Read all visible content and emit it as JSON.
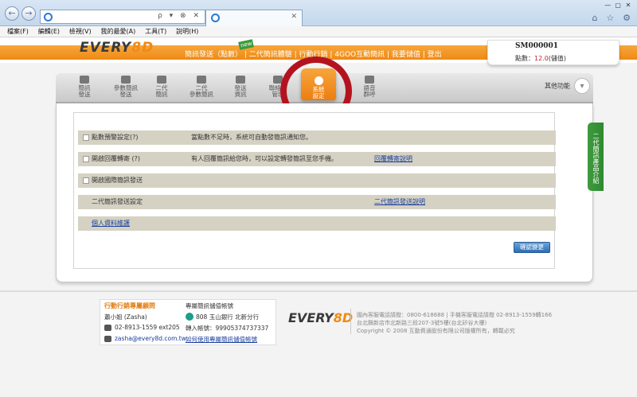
{
  "browser": {
    "back": "←",
    "forward": "→",
    "address_controls": "ρ ▾ ⊗ ✕",
    "tab_close": "✕",
    "window_controls": [
      "—",
      "▢",
      "✕"
    ],
    "right_icons": [
      "⌂",
      "☆",
      "⚙"
    ]
  },
  "menubar": [
    "檔案(F)",
    "編輯(E)",
    "檢視(V)",
    "我的最愛(A)",
    "工具(T)",
    "說明(H)"
  ],
  "site": {
    "logo_prefix": "EVERY",
    "logo_suffix": "8D",
    "new_badge": "new",
    "topnav": "簡訊發送（點數） | 二代簡訊體驗 | 行動行銷 | 4GOO互動簡訊 | 我要儲值 | 登出",
    "account": {
      "id": "SM000001",
      "points_label": "點數：",
      "points_value": "12.0",
      "topup": "(儲值)"
    }
  },
  "toolbar": {
    "items": [
      {
        "label": "簡訊\n發送"
      },
      {
        "label": "參數簡訊\n發送"
      },
      {
        "label": "二代\n簡訊"
      },
      {
        "label": "二代\n參數簡訊"
      },
      {
        "label": "發送\n資訊"
      },
      {
        "label": "聯絡人\n管理"
      },
      {
        "label": "系統\n設定"
      },
      {
        "label": "語音\n群呼"
      }
    ],
    "other": "其他功能",
    "other_icon": "▾"
  },
  "settings": {
    "rows": [
      {
        "label": "點數預警設定(?)",
        "desc": "當點數不足時，系統可自動發簡訊通知您。",
        "link": ""
      },
      {
        "label": "開啟回覆轉寄 (?)",
        "desc": "有人回覆簡訊給您時，可以設定轉發簡訊至您手機。",
        "link": "回覆轉寄說明"
      },
      {
        "label": "開啟國際簡訊發送",
        "desc": "",
        "link": ""
      },
      {
        "label": "二代簡訊發送設定",
        "desc": "",
        "link": "二代簡訊發送說明"
      },
      {
        "label": "個人資料維護",
        "desc": "",
        "link": ""
      }
    ],
    "confirm": "確認變更"
  },
  "side_tab": "二代簡訊產品介紹",
  "footer": {
    "contact_title": "行動行銷專屬顧問",
    "contact_name": "蕭小姐 (Zasha)",
    "phone": "02-8913-1559 ext205",
    "email": "zasha@every8d.com.tw",
    "bank_title": "專屬簡訊儲值帳號",
    "bank": "808 玉山銀行 北新分行",
    "account_no": "轉入帳號：99905374737337",
    "bank_link": "如何使用專屬簡訊儲值帳號",
    "logo_prefix": "EVERY",
    "logo_suffix": "8D",
    "info": [
      "國內客服電話請撥：0800-618688 | 手機客服電話請撥 02-8913-1559轉166",
      "台北縣新店市北新路三段207-3號5樓(台北矽谷大樓)",
      "Copyright © 2008 互動資通股份有限公司版權所有，轉載必究"
    ]
  }
}
